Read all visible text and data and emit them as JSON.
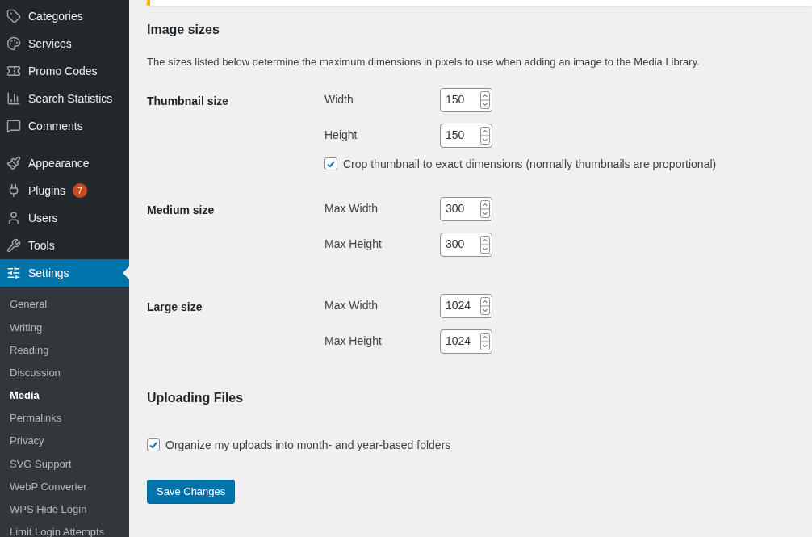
{
  "sidebar": {
    "menu_groups": [
      [
        {
          "label": "Categories",
          "selected": false
        },
        {
          "label": "Services",
          "selected": false
        },
        {
          "label": "Promo Codes",
          "selected": false
        },
        {
          "label": "Search Statistics",
          "selected": false
        },
        {
          "label": "Comments",
          "selected": false
        }
      ],
      [
        {
          "label": "Appearance",
          "selected": false
        },
        {
          "label": "Plugins",
          "selected": false,
          "badge": "7"
        },
        {
          "label": "Users",
          "selected": false
        },
        {
          "label": "Tools",
          "selected": false
        },
        {
          "label": "Settings",
          "selected": true
        }
      ]
    ],
    "submenu": [
      {
        "label": "General",
        "selected": false
      },
      {
        "label": "Writing",
        "selected": false
      },
      {
        "label": "Reading",
        "selected": false
      },
      {
        "label": "Discussion",
        "selected": false
      },
      {
        "label": "Media",
        "selected": true
      },
      {
        "label": "Permalinks",
        "selected": false
      },
      {
        "label": "Privacy",
        "selected": false
      },
      {
        "label": "SVG Support",
        "selected": false
      },
      {
        "label": "WebP Converter",
        "selected": false
      },
      {
        "label": "WPS Hide Login",
        "selected": false
      },
      {
        "label": "Limit Login Attempts",
        "selected": false
      }
    ]
  },
  "image_sizes": {
    "title": "Image sizes",
    "description": "The sizes listed below determine the maximum dimensions in pixels to use when adding an image to the Media Library.",
    "groups": [
      {
        "label": "Thumbnail size",
        "fields": [
          {
            "label": "Width",
            "value": "150"
          },
          {
            "label": "Height",
            "value": "150"
          }
        ],
        "option": {
          "label": "Crop thumbnail to exact dimensions (normally thumbnails are proportional)",
          "checked": true
        }
      },
      {
        "label": "Medium size",
        "fields": [
          {
            "label": "Max Width",
            "value": "300"
          },
          {
            "label": "Max Height",
            "value": "300"
          }
        ]
      },
      {
        "label": "Large size",
        "fields": [
          {
            "label": "Max Width",
            "value": "1024"
          },
          {
            "label": "Max Height",
            "value": "1024"
          }
        ]
      }
    ]
  },
  "uploading": {
    "title": "Uploading Files",
    "option": {
      "label": "Organize my uploads into month- and year-based folders",
      "checked": true
    }
  },
  "save_button": "Save Changes"
}
